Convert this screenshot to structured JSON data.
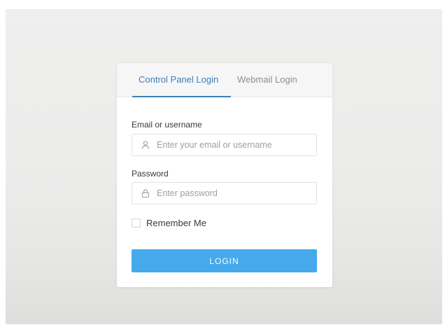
{
  "tabs": [
    {
      "label": "Control Panel Login",
      "active": true
    },
    {
      "label": "Webmail Login",
      "active": false
    }
  ],
  "form": {
    "email_label": "Email or username",
    "email_placeholder": "Enter your email or username",
    "email_icon": "user-icon",
    "password_label": "Password",
    "password_placeholder": "Enter password",
    "password_icon": "lock-icon",
    "remember_label": "Remember Me",
    "remember_checked": false,
    "login_label": "LOGIN"
  },
  "colors": {
    "accent": "#3e7fb8",
    "button": "#45a9ec",
    "background": "#ebebea"
  }
}
